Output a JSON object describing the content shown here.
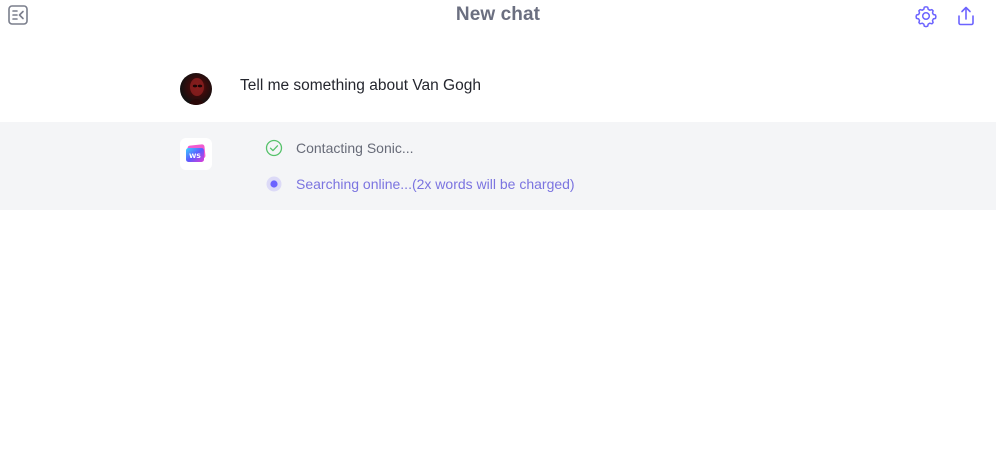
{
  "header": {
    "title": "New chat",
    "icons": {
      "sidebar_toggle": "sidebar-collapse-icon",
      "settings": "gear-icon",
      "share": "share-icon"
    }
  },
  "messages": {
    "user": {
      "text": "Tell me something about Van Gogh"
    },
    "assistant": {
      "avatar_text": "WS",
      "steps": [
        {
          "status": "done",
          "text": "Contacting Sonic..."
        },
        {
          "status": "in-progress",
          "text": "Searching online...(2x words will be charged)"
        }
      ]
    }
  },
  "colors": {
    "accent": "#6c63ff",
    "success": "#56c26b",
    "title": "#6b6f80",
    "panel_bg": "#f4f5f7"
  }
}
